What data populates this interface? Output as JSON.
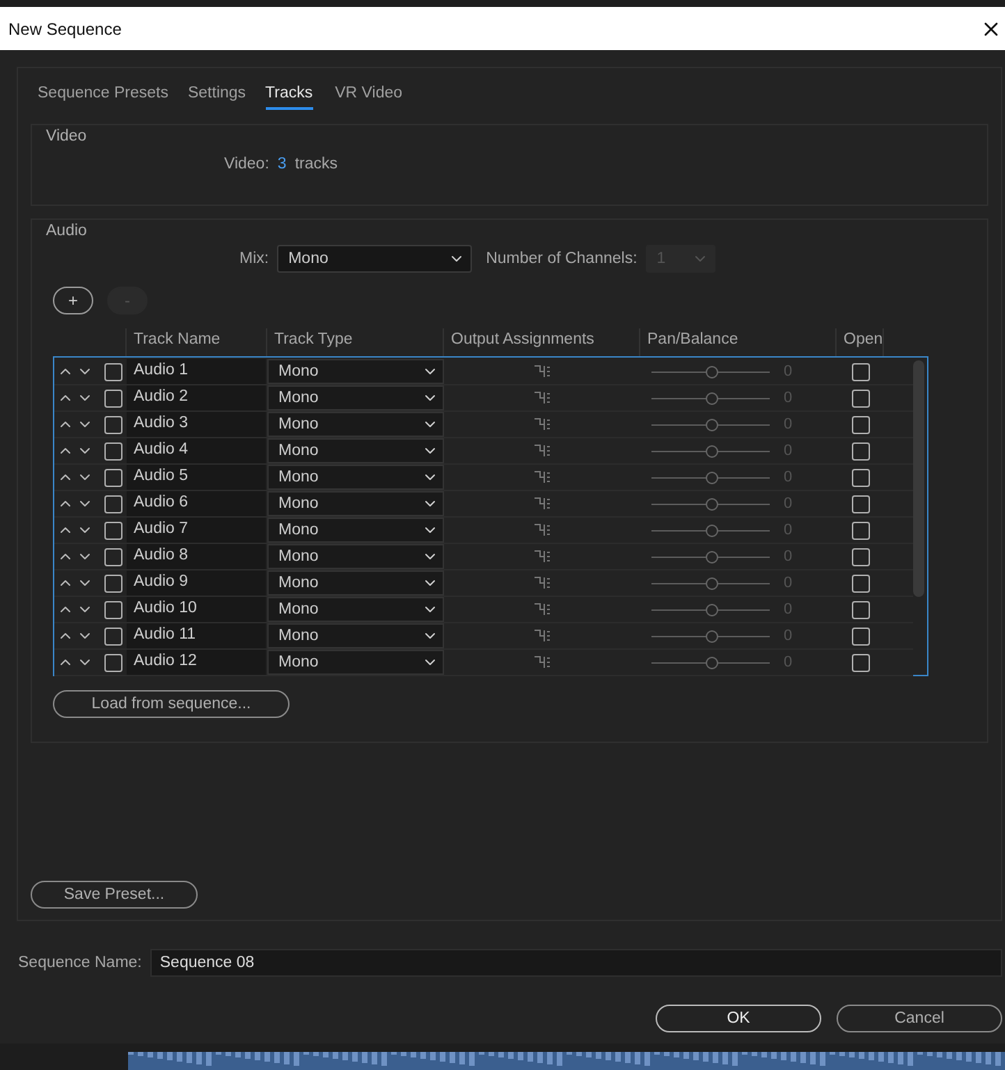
{
  "window": {
    "title": "New Sequence"
  },
  "tabs": [
    {
      "label": "Sequence Presets",
      "selected": false
    },
    {
      "label": "Settings",
      "selected": false
    },
    {
      "label": "Tracks",
      "selected": true
    },
    {
      "label": "VR Video",
      "selected": false
    }
  ],
  "video": {
    "title": "Video",
    "label": "Video:",
    "count": "3",
    "unit": "tracks"
  },
  "audio": {
    "title": "Audio",
    "mix_label": "Mix:",
    "mix_value": "Mono",
    "channels_label": "Number of Channels:",
    "channels_value": "1",
    "channels_disabled": true,
    "add_button": {
      "label": "+",
      "disabled": false
    },
    "remove_button": {
      "label": "-",
      "disabled": true
    },
    "columns": [
      "Track Name",
      "Track Type",
      "Output Assignments",
      "Pan/Balance",
      "Open"
    ],
    "rows": [
      {
        "name": "Audio 1",
        "type": "Mono",
        "level": 0.5,
        "pan": "0",
        "checked": false,
        "open": false
      },
      {
        "name": "Audio 2",
        "type": "Mono",
        "level": 0.5,
        "pan": "0",
        "checked": false,
        "open": false
      },
      {
        "name": "Audio 3",
        "type": "Mono",
        "level": 0.5,
        "pan": "0",
        "checked": false,
        "open": false
      },
      {
        "name": "Audio 4",
        "type": "Mono",
        "level": 0.5,
        "pan": "0",
        "checked": false,
        "open": false
      },
      {
        "name": "Audio 5",
        "type": "Mono",
        "level": 0.5,
        "pan": "0",
        "checked": false,
        "open": false
      },
      {
        "name": "Audio 6",
        "type": "Mono",
        "level": 0.5,
        "pan": "0",
        "checked": false,
        "open": false
      },
      {
        "name": "Audio 7",
        "type": "Mono",
        "level": 0.5,
        "pan": "0",
        "checked": false,
        "open": false
      },
      {
        "name": "Audio 8",
        "type": "Mono",
        "level": 0.5,
        "pan": "0",
        "checked": false,
        "open": false
      },
      {
        "name": "Audio 9",
        "type": "Mono",
        "level": 0.5,
        "pan": "0",
        "checked": false,
        "open": false
      },
      {
        "name": "Audio 10",
        "type": "Mono",
        "level": 0.5,
        "pan": "0",
        "checked": false,
        "open": false
      },
      {
        "name": "Audio 11",
        "type": "Mono",
        "level": 0.5,
        "pan": "0",
        "checked": false,
        "open": false
      },
      {
        "name": "Audio 12",
        "type": "Mono",
        "level": 0.5,
        "pan": "0",
        "checked": false,
        "open": false
      }
    ],
    "load_button": "Load from sequence..."
  },
  "save_preset": "Save Preset...",
  "sequence_name": {
    "label": "Sequence Name:",
    "value": "Sequence 08"
  },
  "buttons": {
    "ok": "OK",
    "cancel": "Cancel"
  }
}
